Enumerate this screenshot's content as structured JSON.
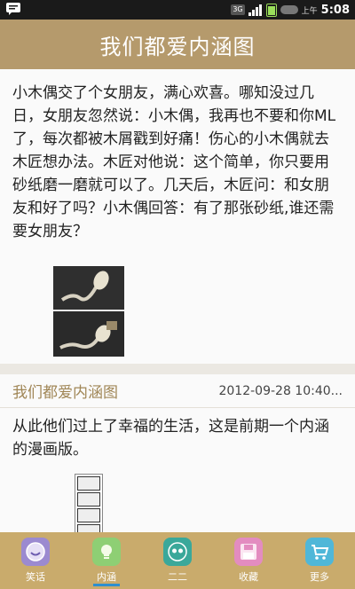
{
  "status_bar": {
    "network": "3G",
    "ampm": "上午",
    "time": "5:08"
  },
  "app": {
    "title": "我们都爱内涵图"
  },
  "posts": [
    {
      "text": "小木偶交了个女朋友，满心欢喜。哪知没过几日，女朋友忽然说：小木偶，我再也不要和你ML了，每次都被木屑戳到好痛！伤心的小木偶就去木匠想办法。木匠对他说：这个简单，你只要用砂纸磨一磨就可以了。几天后，木匠问：和女朋友和好了吗？小木偶回答：有了那张砂纸,谁还需要女朋友？"
    },
    {
      "author": "我们都爱内涵图",
      "date": "2012-09-28 10:40...",
      "text": "从此他们过上了幸福的生活，这是前期一个内涵的漫画版。"
    }
  ],
  "tabs": [
    {
      "label": "笑话",
      "icon": "smiley-icon",
      "color": "#9b8ad0"
    },
    {
      "label": "内涵",
      "icon": "lightbulb-icon",
      "color": "#8ecf74",
      "active": true
    },
    {
      "label": "二二",
      "icon": "mask-icon",
      "color": "#3aa89a"
    },
    {
      "label": "收藏",
      "icon": "floppy-disk-icon",
      "color": "#e38cc0"
    },
    {
      "label": "更多",
      "icon": "cart-icon",
      "color": "#4fb7d8"
    }
  ]
}
